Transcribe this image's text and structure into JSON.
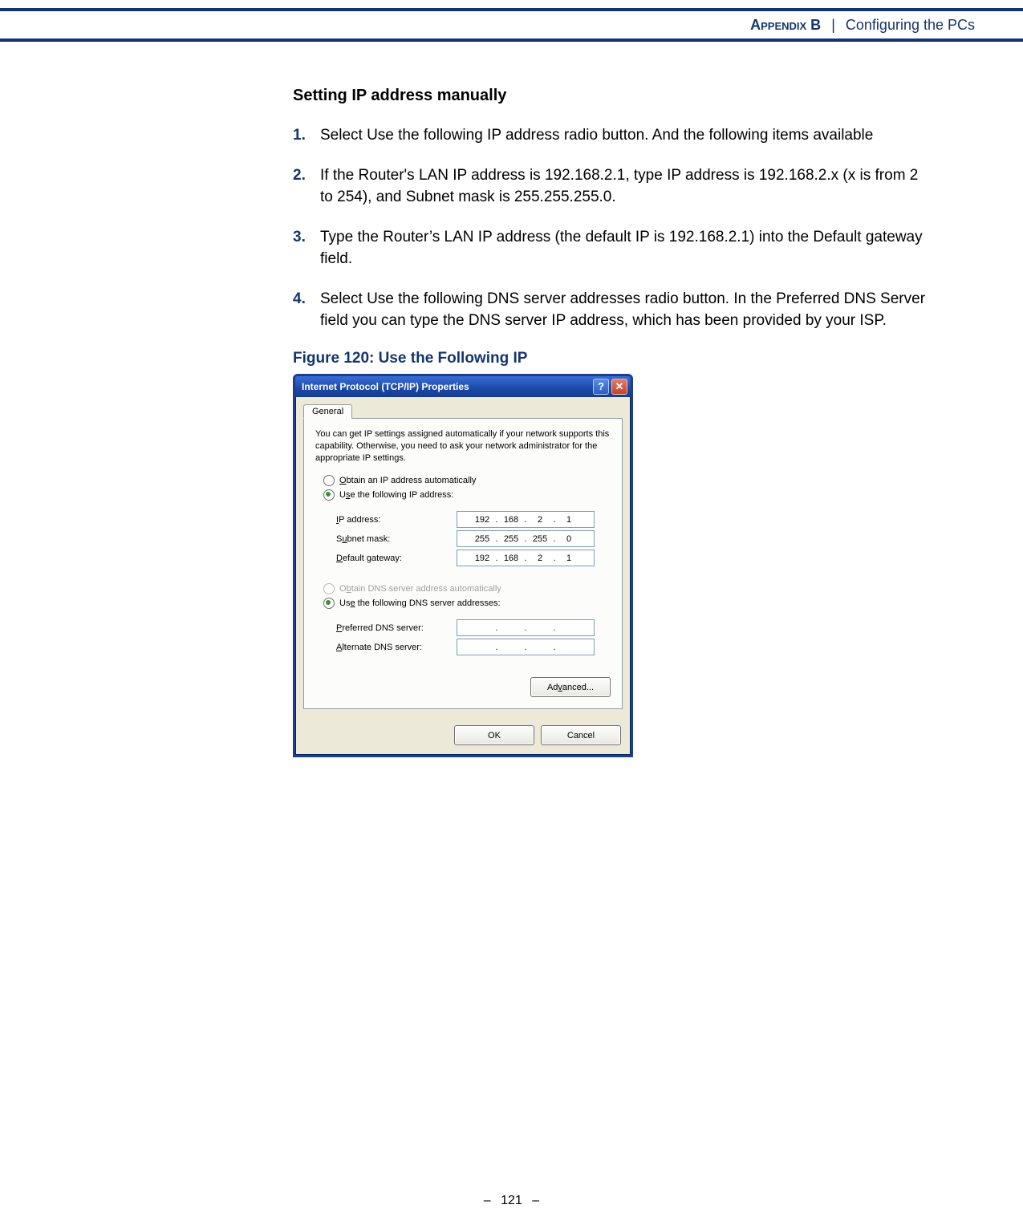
{
  "header": {
    "appendix_label": "Appendix B",
    "separator": "|",
    "chapter_title": "Configuring the PCs"
  },
  "section_title": "Setting IP address manually",
  "steps": [
    {
      "num": "1.",
      "text": "Select Use the following IP address radio button. And the following items available"
    },
    {
      "num": "2.",
      "text": "If the Router's LAN IP address is 192.168.2.1, type IP address is 192.168.2.x (x is from 2 to 254), and Subnet mask is 255.255.255.0."
    },
    {
      "num": "3.",
      "text": "Type the Router’s LAN IP address (the default IP is 192.168.2.1) into the Default gateway field."
    },
    {
      "num": "4.",
      "text": "Select Use the following DNS server addresses radio button. In the Preferred DNS Server field you can type the DNS server IP address, which has been provided by your ISP."
    }
  ],
  "figure_caption": "Figure 120:  Use the Following IP",
  "dialog": {
    "title": "Internet Protocol (TCP/IP) Properties",
    "help_symbol": "?",
    "close_symbol": "✕",
    "tab_label": "General",
    "intro_text": "You can get IP settings assigned automatically if your network supports this capability. Otherwise, you need to ask your network administrator for the appropriate IP settings.",
    "radio_obtain_ip_prefix": "O",
    "radio_obtain_ip_rest": "btain an IP address automatically",
    "radio_use_ip_prefix": "s",
    "radio_use_ip_pre": "U",
    "radio_use_ip_rest": "e the following IP address:",
    "label_ip_prefix": "I",
    "label_ip_rest": "P address:",
    "label_subnet_prefix": "u",
    "label_subnet_pre": "S",
    "label_subnet_rest": "bnet mask:",
    "label_gateway_prefix": "D",
    "label_gateway_rest": "efault gateway:",
    "ip_address": {
      "o1": "192",
      "o2": "168",
      "o3": "2",
      "o4": "1"
    },
    "subnet_mask": {
      "o1": "255",
      "o2": "255",
      "o3": "255",
      "o4": "0"
    },
    "default_gateway": {
      "o1": "192",
      "o2": "168",
      "o3": "2",
      "o4": "1"
    },
    "radio_obtain_dns_prefix": "b",
    "radio_obtain_dns_pre": "O",
    "radio_obtain_dns_rest": "tain DNS server address automatically",
    "radio_use_dns_prefix": "e",
    "radio_use_dns_pre": "Us",
    "radio_use_dns_rest": " the following DNS server addresses:",
    "label_pref_dns_prefix": "P",
    "label_pref_dns_rest": "referred DNS server:",
    "label_alt_dns_prefix": "A",
    "label_alt_dns_rest": "lternate DNS server:",
    "pref_dns": {
      "o1": "",
      "o2": "",
      "o3": "",
      "o4": ""
    },
    "alt_dns": {
      "o1": "",
      "o2": "",
      "o3": "",
      "o4": ""
    },
    "advanced_label_prefix": "v",
    "advanced_label_pre": "Ad",
    "advanced_label_rest": "anced...",
    "ok_label": "OK",
    "cancel_label": "Cancel",
    "dot": "."
  },
  "footer": {
    "dash": "–",
    "page_number": "121"
  }
}
